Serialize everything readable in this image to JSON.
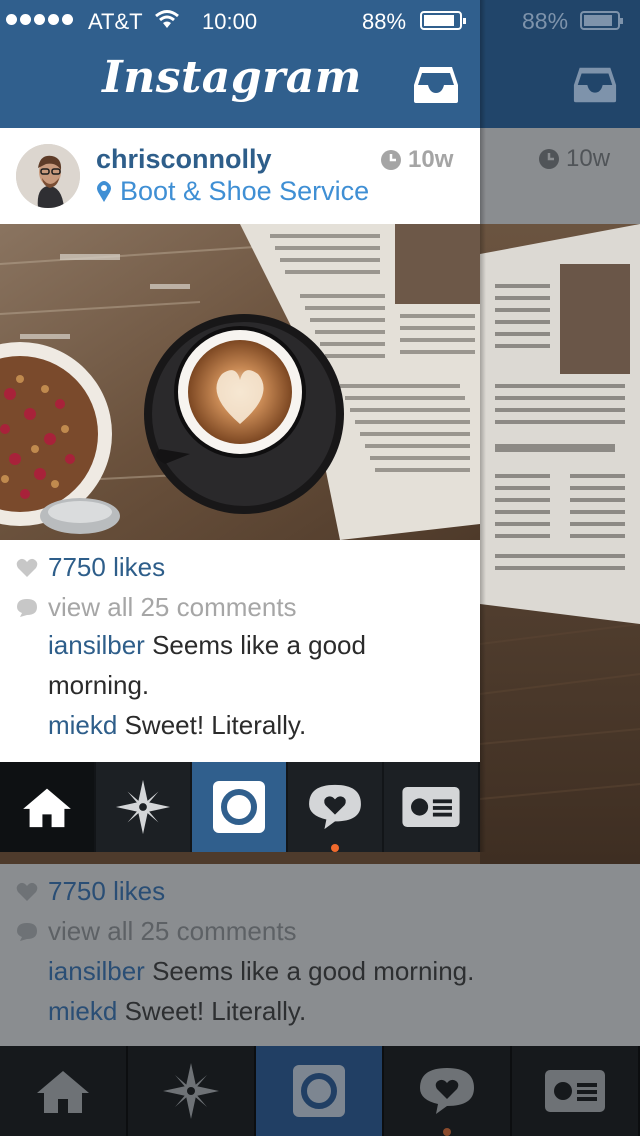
{
  "status_bar": {
    "carrier": "AT&T",
    "time": "10:00",
    "battery": "88%",
    "signal_icon": "signal-dots-icon",
    "wifi_icon": "wifi-icon"
  },
  "nav_bar": {
    "logo": "Instagram",
    "inbox_icon": "inbox-icon"
  },
  "post": {
    "username": "chrisconnolly",
    "location": "Boot & Shoe Service",
    "time_ago": "10w",
    "likes": "7750 likes",
    "view_comments": "view all 25 comments",
    "comments": [
      {
        "author": "iansilber",
        "text": "Seems like a good morning."
      },
      {
        "author": "miekd",
        "text": "Sweet!  Literally."
      }
    ]
  },
  "tab_bar": {
    "tabs": [
      {
        "name": "home",
        "icon": "home-icon",
        "active": false
      },
      {
        "name": "explore",
        "icon": "compass-star-icon",
        "active": false
      },
      {
        "name": "camera",
        "icon": "camera-icon",
        "active": true
      },
      {
        "name": "news",
        "icon": "heart-bubble-icon",
        "active": false,
        "notification": true
      },
      {
        "name": "profile",
        "icon": "profile-card-icon",
        "active": false
      }
    ]
  },
  "colors": {
    "brand_blue": "#305f8d",
    "link_blue": "#2e5e8a",
    "location_blue": "#3f8fd4",
    "notification_orange": "#f06a2d"
  }
}
